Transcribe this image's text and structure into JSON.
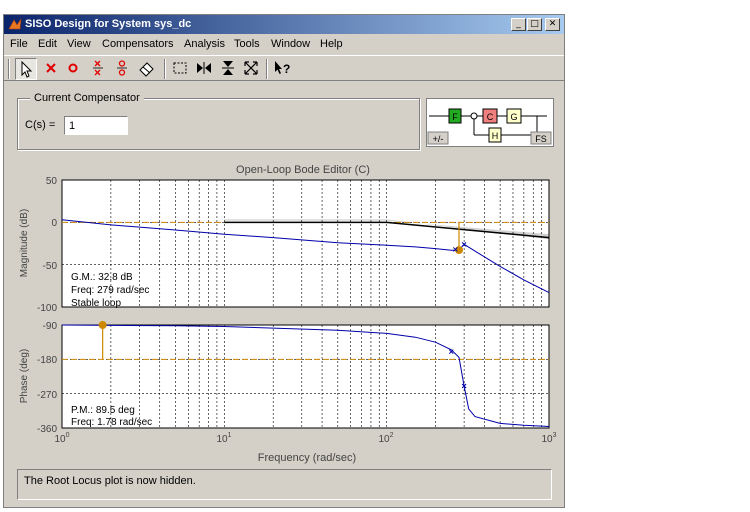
{
  "window": {
    "title": "SISO Design for System sys_dc",
    "buttons": {
      "minimize": "_",
      "maximize": "□",
      "close": "✕"
    }
  },
  "menubar": [
    "File",
    "Edit",
    "View",
    "Compensators",
    "Analysis",
    "Tools",
    "Window",
    "Help"
  ],
  "toolbar": {
    "tools": [
      "select-icon",
      "add-pole-icon",
      "add-zero-icon",
      "add-complex-pole-icon",
      "add-complex-zero-icon",
      "eraser-icon",
      "zoom-box-icon",
      "zoom-x-icon",
      "zoom-y-icon",
      "fit-icon",
      "whats-this-icon"
    ]
  },
  "compensator": {
    "legend": "Current Compensator",
    "label": "C(s) =",
    "value": "1"
  },
  "diagram": {
    "blocks": [
      "F",
      "C",
      "G",
      "H"
    ],
    "sign_button": "+/-",
    "fs_button": "FS",
    "colors": {
      "F": "#22aa22",
      "C": "#f08080",
      "G": "#ffffcc",
      "H": "#ffffcc"
    }
  },
  "plot": {
    "title": "Open-Loop Bode Editor (C)",
    "xlabel": "Frequency (rad/sec)",
    "mag": {
      "ylabel": "Magnitude (dB)",
      "yticks": [
        "50",
        "0",
        "-50",
        "-100"
      ],
      "annotations": [
        "G.M.: 32.8 dB",
        "Freq: 279 rad/sec",
        "Stable loop"
      ]
    },
    "phase": {
      "ylabel": "Phase (deg)",
      "yticks": [
        "-90",
        "-180",
        "-270",
        "-360"
      ],
      "annotations": [
        "P.M.: 89.5 deg",
        "Freq: 1.78 rad/sec"
      ]
    },
    "xticks": [
      {
        "base": "10",
        "exp": "0"
      },
      {
        "base": "10",
        "exp": "1"
      },
      {
        "base": "10",
        "exp": "2"
      },
      {
        "base": "10",
        "exp": "3"
      }
    ],
    "colors": {
      "curve": "#0000aa",
      "margin": "#cc8800",
      "grid": "#000000"
    }
  },
  "chart_data": [
    {
      "type": "line",
      "title": "Open-Loop Bode Editor (C)",
      "xlabel": "Frequency (rad/sec)",
      "ylabel": "Magnitude (dB)",
      "xscale": "log",
      "xlim": [
        1,
        1000
      ],
      "ylim": [
        -100,
        50
      ],
      "grid": true,
      "series": [
        {
          "x": [
            1,
            2,
            5,
            10,
            20,
            50,
            100,
            150,
            200,
            250,
            279,
            300,
            350,
            500,
            700,
            1000
          ],
          "y": [
            3,
            -3,
            -9,
            -14,
            -18,
            -24,
            -27,
            -29,
            -31,
            -33,
            -33,
            -26,
            -34,
            -52,
            -68,
            -83
          ]
        }
      ],
      "reference_line": 0,
      "gain_margin": {
        "freq": 279,
        "value_db": -32.8
      }
    },
    {
      "type": "line",
      "xlabel": "Frequency (rad/sec)",
      "ylabel": "Phase (deg)",
      "xscale": "log",
      "xlim": [
        1,
        1000
      ],
      "ylim": [
        -360,
        -90
      ],
      "grid": true,
      "series": [
        {
          "x": [
            1,
            2,
            5,
            10,
            20,
            50,
            100,
            150,
            200,
            250,
            279,
            300,
            320,
            350,
            500,
            700,
            1000
          ],
          "y": [
            -90,
            -91,
            -92,
            -94,
            -98,
            -104,
            -112,
            -122,
            -135,
            -155,
            -175,
            -250,
            -310,
            -330,
            -348,
            -353,
            -356
          ]
        }
      ],
      "reference_line": -180,
      "phase_margin": {
        "freq": 1.78,
        "value_deg": 89.5
      }
    }
  ],
  "status": "The Root Locus plot is now hidden."
}
